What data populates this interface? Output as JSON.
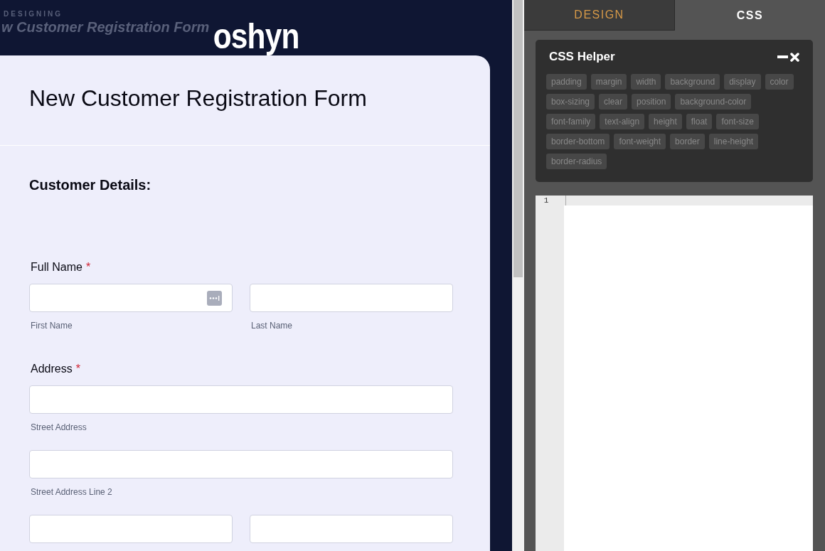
{
  "preview": {
    "caption": "DESIGNING",
    "ghost_title": "w Customer Registration Form",
    "logo": "oshyn"
  },
  "form": {
    "title": "New Customer Registration Form",
    "section": "Customer Details:",
    "fields": [
      {
        "label": "Full Name",
        "required_mark": "*",
        "rows": [
          [
            {
              "sublabel": "First Name",
              "autofill_icon": true
            },
            {
              "sublabel": "Last Name",
              "autofill_icon": false
            }
          ]
        ]
      },
      {
        "label": "Address",
        "required_mark": "*",
        "rows": [
          [
            {
              "sublabel": "Street Address",
              "autofill_icon": false
            }
          ],
          [
            {
              "sublabel": "Street Address Line 2",
              "autofill_icon": false
            }
          ],
          [
            {
              "autofill_icon": false
            },
            {
              "autofill_icon": false
            }
          ]
        ]
      }
    ]
  },
  "tabs": [
    {
      "label": "DESIGN",
      "selected": false
    },
    {
      "label": "CSS",
      "selected": true
    }
  ],
  "helper": {
    "title": "CSS Helper",
    "properties": [
      "padding",
      "margin",
      "width",
      "background",
      "display",
      "color",
      "box-sizing",
      "clear",
      "position",
      "background-color",
      "font-family",
      "text-align",
      "height",
      "float",
      "font-size",
      "border-bottom",
      "font-weight",
      "border",
      "line-height",
      "border-radius"
    ]
  },
  "editor": {
    "line_numbers": [
      "1"
    ]
  }
}
